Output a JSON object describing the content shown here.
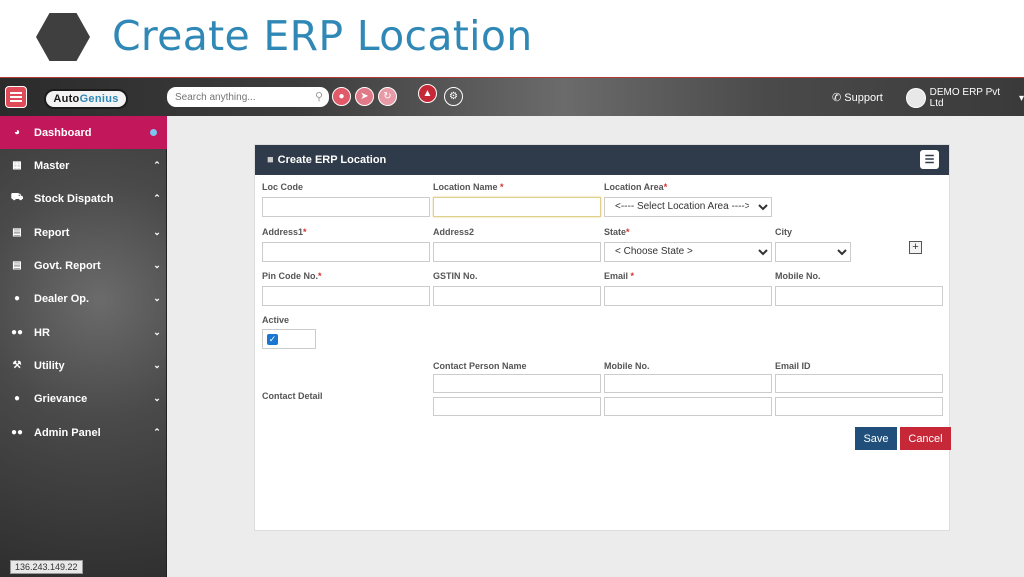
{
  "slide": {
    "title": "Create ERP Location"
  },
  "topbar": {
    "logo_text_a": "Auto",
    "logo_text_b": "Genius",
    "search_placeholder": "Search anything...",
    "support_label": "Support",
    "user_label": "DEMO ERP Pvt Ltd"
  },
  "sidebar": {
    "items": [
      {
        "label": "Dashboard",
        "icon": "dashboard-icon"
      },
      {
        "label": "Master",
        "icon": "grid-icon"
      },
      {
        "label": "Stock Dispatch",
        "icon": "truck-icon"
      },
      {
        "label": "Report",
        "icon": "report-icon"
      },
      {
        "label": "Govt. Report",
        "icon": "document-icon"
      },
      {
        "label": "Dealer Op.",
        "icon": "user-icon"
      },
      {
        "label": "HR",
        "icon": "users-icon"
      },
      {
        "label": "Utility",
        "icon": "wrench-icon"
      },
      {
        "label": "Grievance",
        "icon": "chat-icon"
      },
      {
        "label": "Admin Panel",
        "icon": "admin-icon"
      }
    ],
    "ip": "136.243.149.22"
  },
  "form": {
    "header": "Create ERP Location",
    "loc_code_label": "Loc Code",
    "location_name_label": "Location Name",
    "location_area_label": "Location Area",
    "location_area_value": "<---- Select Location Area ---->",
    "address1_label": "Address1",
    "address2_label": "Address2",
    "state_label": "State",
    "state_value": "< Choose State >",
    "city_label": "City",
    "pin_label": "Pin Code No.",
    "gstin_label": "GSTIN No.",
    "email_label": "Email",
    "mobile_label": "Mobile No.",
    "active_label": "Active",
    "contact_detail_label": "Contact Detail",
    "contact_person_label": "Contact Person Name",
    "contact_mobile_label": "Mobile No.",
    "contact_email_label": "Email ID",
    "required_mark": "*",
    "save_label": "Save",
    "cancel_label": "Cancel"
  },
  "colors": {
    "accent": "#2f88b5",
    "active_sidebar": "#c2185b",
    "save": "#1f4f7a",
    "cancel": "#c62838"
  }
}
